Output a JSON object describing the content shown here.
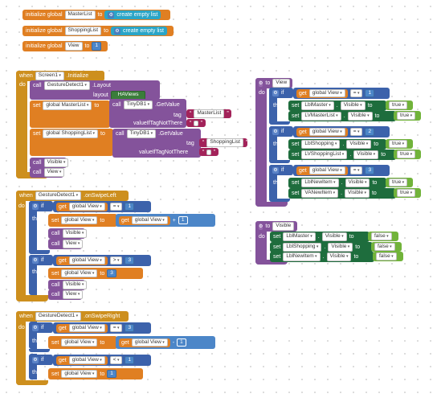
{
  "globals": {
    "init_label": "initialize global",
    "to_label": "to",
    "master_name": "MasterList",
    "shopping_name": "ShoppingList",
    "view_name": "View",
    "create_empty_list": "create empty list",
    "view_init_value": "1"
  },
  "screen_init": {
    "when": "when",
    "component": "Screen1",
    "event": ".Initialize",
    "do": "do",
    "call": "call",
    "gesture": "GestureDetect1",
    "layout_method": ".Layout",
    "layout_param": "layout",
    "layout_value": "HAViews",
    "set": "set",
    "global_master": "global MasterList",
    "global_shopping": "global ShoppingList",
    "to": "to",
    "tinydb": "TinyDB1",
    "get_value": ".GetValue",
    "tag": "tag",
    "master_tag": "MasterList",
    "shopping_tag": "ShoppingList",
    "value_if": "valueIfTagNotThere",
    "call_visible": "Visible",
    "call_view": "View"
  },
  "swipe_left": {
    "when": "when",
    "component": "GestureDetect1",
    "event": ".onSwipeLeft",
    "do": "do",
    "if": "if",
    "then": "then",
    "get": "get",
    "global_view": "global View",
    "eq": "=",
    "gt": ">",
    "plus": "+",
    "one": "1",
    "three": "3",
    "set": "set",
    "to": "to",
    "call": "call",
    "visible": "Visible",
    "view": "View"
  },
  "swipe_right": {
    "when": "when",
    "component": "GestureDetect1",
    "event": ".onSwipeRight",
    "do": "do",
    "if": "if",
    "then": "then",
    "get": "get",
    "global_view": "global View",
    "eq": "=",
    "lt": "<",
    "minus": "-",
    "one": "1",
    "three": "3",
    "set": "set",
    "to": "to",
    "call": "call"
  },
  "proc_view": {
    "to": "to",
    "name": "View",
    "do": "do",
    "if": "if",
    "then": "then",
    "get": "get",
    "global_view": "global View",
    "eq": "=",
    "one": "1",
    "two": "2",
    "three": "3",
    "set": "set",
    "to_kw": "to",
    "visible": "Visible",
    "true": "true",
    "lbl_master": "LblMaster",
    "lv_master": "LVMasterList",
    "lbl_shopping": "LblShopping",
    "lv_shopping": "LVShoppingList",
    "lbl_new": "LblNewItem",
    "va_new": "VANewItem"
  },
  "proc_visible": {
    "to": "to",
    "name": "Visible",
    "do": "do",
    "set": "set",
    "to_kw": "to",
    "visible": "Visible",
    "false": "false",
    "lbl_master": "LblMaster",
    "lbl_shopping": "LblShopping",
    "lbl_new": "LblNewItem"
  }
}
